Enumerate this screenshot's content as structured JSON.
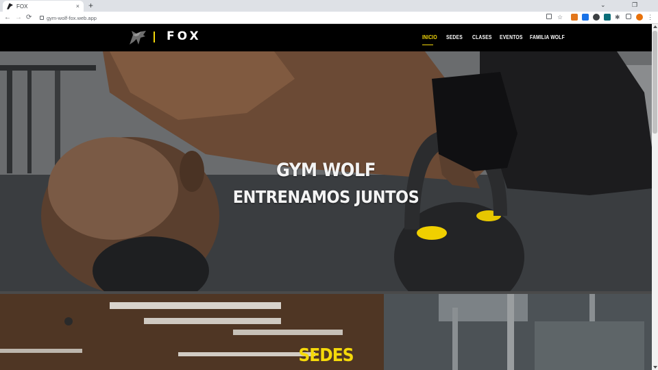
{
  "browser": {
    "tab_title": "FOX",
    "tab_close": "×",
    "new_tab": "+",
    "url": "gym-wolf-fox.web.app",
    "back": "←",
    "forward": "→",
    "reload": "⟳",
    "window_minimize": "⌄",
    "window_restore": "❐"
  },
  "site": {
    "logo_text": "FOX",
    "nav": {
      "inicio": "INICIO",
      "sedes": "SEDES",
      "clases": "CLASES",
      "eventos": "EVENTOS",
      "familia": "FAMILIA WOLF"
    },
    "hero": {
      "line1": "GYM WOLF",
      "line2": "ENTRENAMOS JUNTOS"
    },
    "sedes_title": "SEDES"
  },
  "colors": {
    "accent": "#f5d90a",
    "nav_bg": "#000000",
    "text": "#ffffff"
  },
  "icons": {
    "logo": "wolf-head-icon",
    "kettlebell_accent": "#f0d000"
  }
}
